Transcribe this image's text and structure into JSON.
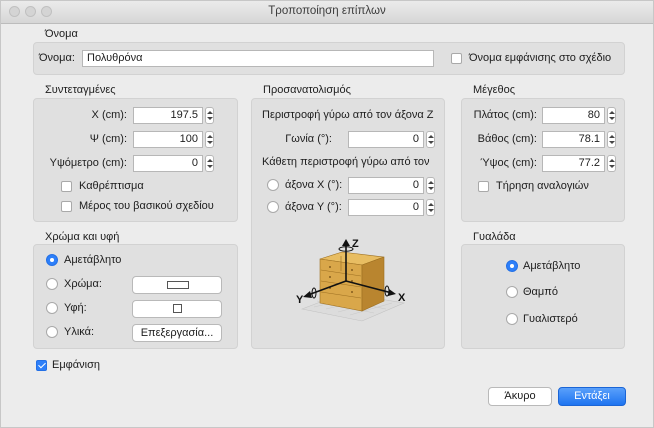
{
  "window": {
    "title": "Τροποποίηση επίπλων"
  },
  "name_section": {
    "header": "Όνομα",
    "name_label": "Όνομα:",
    "name_value": "Πολυθρόνα",
    "show_name_label": "Όνομα εμφάνισης στο σχέδιο",
    "show_name_checked": false
  },
  "coordinates": {
    "header": "Συντεταγμένες",
    "x_label": "Χ (cm):",
    "x_value": "197.5",
    "y_label": "Ψ (cm):",
    "y_value": "100",
    "elevation_label": "Υψόμετρο (cm):",
    "elevation_value": "0",
    "mirror_label": "Καθρέπτισμα",
    "mirror_checked": false,
    "base_plan_label": "Μέρος του βασικού σχεδίου",
    "base_plan_checked": false
  },
  "orientation": {
    "header": "Προσανατολισμός",
    "rotation_z_label": "Περιστροφή γύρω από τον άξονα Ζ",
    "angle_label": "Γωνία (°):",
    "angle_value": "0",
    "vertical_rotation_label": "Κάθετη περιστροφή γύρω από τον",
    "axis_x_label": "άξονα Χ (°):",
    "axis_x_value": "0",
    "axis_x_selected": false,
    "axis_y_label": "άξονα Υ (°):",
    "axis_y_value": "0",
    "axis_y_selected": false,
    "preview_axes": {
      "z": "Z",
      "x": "X",
      "y": "Y"
    }
  },
  "size": {
    "header": "Μέγεθος",
    "width_label": "Πλάτος (cm):",
    "width_value": "80",
    "depth_label": "Βάθος (cm):",
    "depth_value": "78.1",
    "height_label": "Ύψος (cm):",
    "height_value": "77.2",
    "keep_proportions_label": "Τήρηση αναλογιών",
    "keep_proportions_checked": false
  },
  "color_texture": {
    "header": "Χρώμα και υφή",
    "unchanged_label": "Αμετάβλητο",
    "unchanged_selected": true,
    "color_label": "Χρώμα:",
    "texture_label": "Υφή:",
    "materials_label": "Υλικά:",
    "edit_button": "Επεξεργασία..."
  },
  "gloss": {
    "header": "Γυαλάδα",
    "options": [
      {
        "label": "Αμετάβλητο",
        "selected": true
      },
      {
        "label": "Θαμπό",
        "selected": false
      },
      {
        "label": "Γυαλιστερό",
        "selected": false
      }
    ]
  },
  "visible": {
    "label": "Εμφάνιση",
    "checked": true
  },
  "buttons": {
    "cancel": "Άκυρο",
    "ok": "Εντάξει"
  },
  "colors": {
    "accent": "#2d7ff9",
    "panel": "#e0e0e0",
    "window": "#ececec",
    "wood": "#d9a74a"
  }
}
